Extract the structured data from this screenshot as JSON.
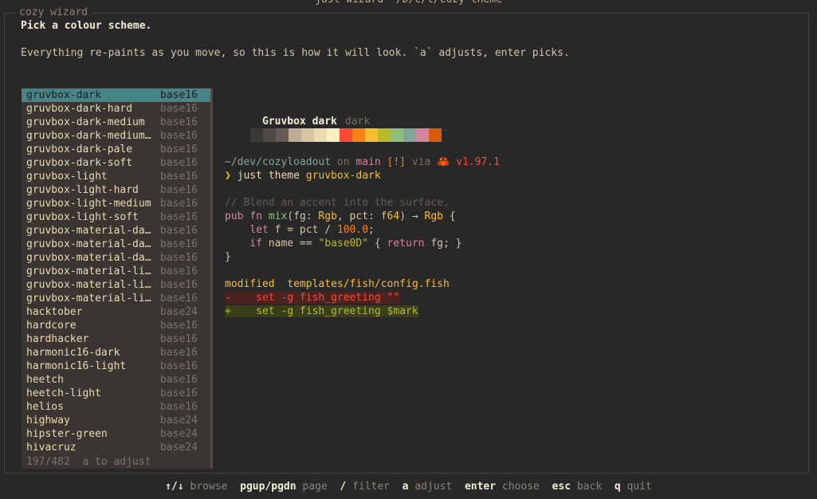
{
  "window_title": "just wizard ~/D/c/t/cozy-theme",
  "frame_label": "cozy wizard",
  "heading": "Pick a colour scheme.",
  "subheading": "Everything re-paints as you move, so this is how it will look. `a` adjusts, enter picks.",
  "list": {
    "items": [
      {
        "name": "gruvbox-dark",
        "base": "base16",
        "selected": true
      },
      {
        "name": "gruvbox-dark-hard",
        "base": "base16"
      },
      {
        "name": "gruvbox-dark-medium",
        "base": "base16"
      },
      {
        "name": "gruvbox-dark-medium…",
        "base": "base16"
      },
      {
        "name": "gruvbox-dark-pale",
        "base": "base16"
      },
      {
        "name": "gruvbox-dark-soft",
        "base": "base16"
      },
      {
        "name": "gruvbox-light",
        "base": "base16"
      },
      {
        "name": "gruvbox-light-hard",
        "base": "base16"
      },
      {
        "name": "gruvbox-light-medium",
        "base": "base16"
      },
      {
        "name": "gruvbox-light-soft",
        "base": "base16"
      },
      {
        "name": "gruvbox-material-da…",
        "base": "base16"
      },
      {
        "name": "gruvbox-material-da…",
        "base": "base16"
      },
      {
        "name": "gruvbox-material-da…",
        "base": "base16"
      },
      {
        "name": "gruvbox-material-li…",
        "base": "base16"
      },
      {
        "name": "gruvbox-material-li…",
        "base": "base16"
      },
      {
        "name": "gruvbox-material-li…",
        "base": "base16"
      },
      {
        "name": "hacktober",
        "base": "base24"
      },
      {
        "name": "hardcore",
        "base": "base16"
      },
      {
        "name": "hardhacker",
        "base": "base16"
      },
      {
        "name": "harmonic16-dark",
        "base": "base16"
      },
      {
        "name": "harmonic16-light",
        "base": "base16"
      },
      {
        "name": "heetch",
        "base": "base16"
      },
      {
        "name": "heetch-light",
        "base": "base16"
      },
      {
        "name": "helios",
        "base": "base16"
      },
      {
        "name": "highway",
        "base": "base24"
      },
      {
        "name": "hipster-green",
        "base": "base24"
      },
      {
        "name": "hivacruz",
        "base": "base24"
      }
    ],
    "footer": "197/482  a to adjust"
  },
  "preview": {
    "theme_name": "Gruvbox dark",
    "theme_variant": "dark",
    "swatches": [
      "#282828",
      "#3c3836",
      "#504945",
      "#665c54",
      "#bdae93",
      "#d5c4a1",
      "#ebdbb2",
      "#fbf1c7",
      "#fb4934",
      "#fe8019",
      "#fabd2f",
      "#b8bb26",
      "#8ec07c",
      "#83a598",
      "#d3869b",
      "#d65d0e"
    ],
    "prompt": {
      "path": "~/dev/cozyloadout",
      "on": "on",
      "branch_icon": "",
      "branch": "main",
      "status": "[!]",
      "via": "via",
      "lang_icon": "🦀",
      "version": "v1.97.1"
    },
    "command": {
      "arrow": "❯",
      "text": "just theme",
      "arg": "gruvbox-dark"
    },
    "code": {
      "comment": "// Blend an accent into the surface.",
      "l2": {
        "kw1": "pub",
        "kw2": "fn",
        "fn": "mix",
        "p1": "(fg: ",
        "t1": "Rgb",
        "p2": ", pct: ",
        "t2": "f64",
        "p3": ") → ",
        "t3": "Rgb",
        "p4": " {"
      },
      "l3": {
        "indent": "    ",
        "kw": "let",
        "p1": " f = pct / ",
        "num": "100.0",
        "p2": ";"
      },
      "l4": {
        "indent": "    ",
        "kw": "if",
        "p1": " name == ",
        "str": "\"base0D\"",
        "p2": " { ",
        "kw2": "return",
        "p3": " fg; }"
      },
      "l5": "}"
    },
    "diff": {
      "status": "modified",
      "file": "templates/fish/config.fish",
      "removed": "-    set -g fish_greeting \"\"",
      "added": "+    set -g fish_greeting $mark"
    }
  },
  "hints": [
    {
      "key": "↑/↓",
      "desc": "browse"
    },
    {
      "key": "pgup/pgdn",
      "desc": "page"
    },
    {
      "key": "/",
      "desc": "filter"
    },
    {
      "key": "a",
      "desc": "adjust"
    },
    {
      "key": "enter",
      "desc": "choose"
    },
    {
      "key": "esc",
      "desc": "back"
    },
    {
      "key": "q",
      "desc": "quit"
    }
  ]
}
